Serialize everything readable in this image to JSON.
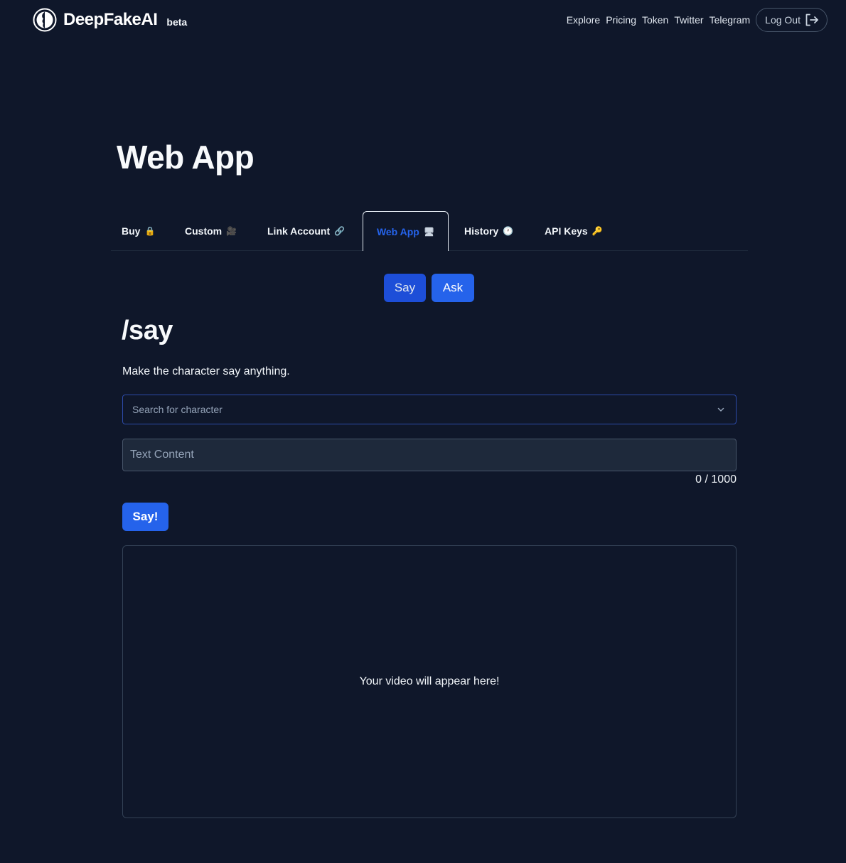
{
  "header": {
    "brand": "DeepFakeAI",
    "badge": "beta",
    "links": [
      "Explore",
      "Pricing",
      "Token",
      "Twitter",
      "Telegram"
    ],
    "logout_label": "Log Out"
  },
  "page": {
    "title": "Web App"
  },
  "tabs": [
    {
      "label": "Buy",
      "icon": "lock-icon",
      "glyph": "🔒"
    },
    {
      "label": "Custom",
      "icon": "movie-camera-icon",
      "glyph": "🎥"
    },
    {
      "label": "Link Account",
      "icon": "link-icon",
      "glyph": "🔗"
    },
    {
      "label": "Web App",
      "icon": "desktop-icon",
      "glyph": "🖥",
      "active": true
    },
    {
      "label": "History",
      "icon": "clock-icon",
      "glyph": "🕐"
    },
    {
      "label": "API Keys",
      "icon": "key-icon",
      "glyph": "🔑"
    }
  ],
  "modes": [
    {
      "label": "Say",
      "selected": true
    },
    {
      "label": "Ask",
      "selected": false
    }
  ],
  "form": {
    "heading": "/say",
    "description": "Make the character say anything.",
    "character_placeholder": "Search for character",
    "text_placeholder": "Text Content",
    "text_value": "",
    "counter": "0 / 1000",
    "submit_label": "Say!"
  },
  "output": {
    "placeholder": "Your video will appear here!"
  },
  "colors": {
    "background": "#0f172a",
    "accent": "#2563eb",
    "selected_mode": "#1d4ed8",
    "select_border": "#2c4aa8"
  }
}
